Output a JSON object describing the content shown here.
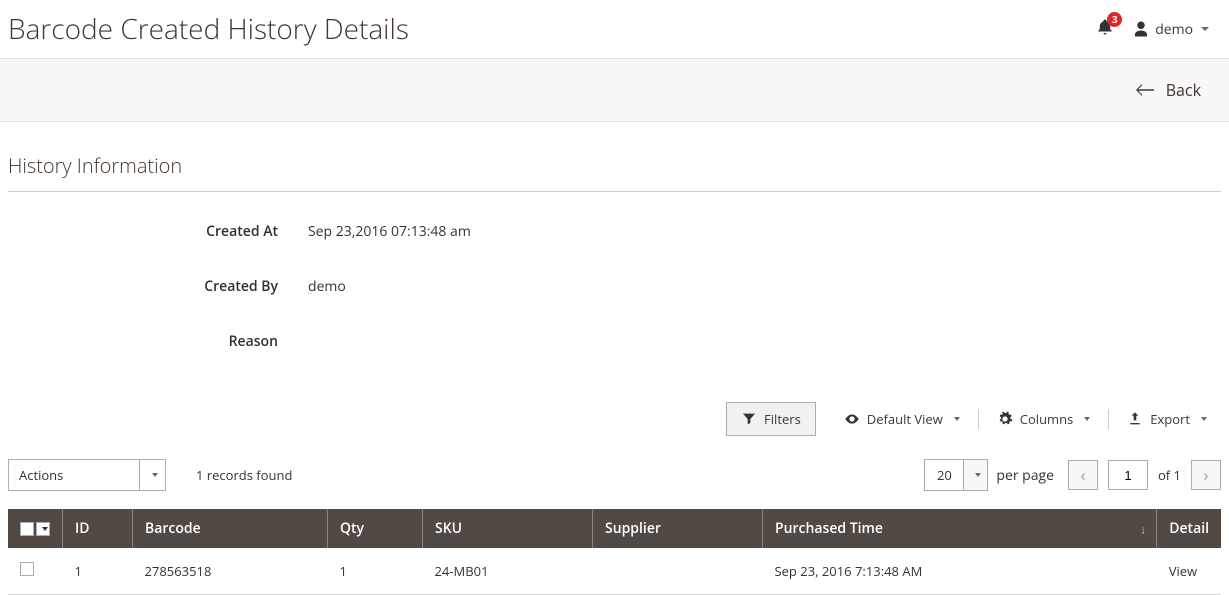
{
  "header": {
    "page_title": "Barcode Created History Details",
    "notification_count": "3",
    "user_name": "demo"
  },
  "back_bar": {
    "back_label": "Back"
  },
  "section": {
    "title": "History Information",
    "rows": {
      "created_at": {
        "label": "Created At",
        "value": "Sep 23,2016 07:13:48 am"
      },
      "created_by": {
        "label": "Created By",
        "value": "demo"
      },
      "reason": {
        "label": "Reason",
        "value": ""
      }
    }
  },
  "toolbar": {
    "filters_label": "Filters",
    "default_view_label": "Default View",
    "columns_label": "Columns",
    "export_label": "Export"
  },
  "grid_controls": {
    "actions_label": "Actions",
    "records_text": "1 records found",
    "per_page_value": "20",
    "per_page_label": "per page",
    "current_page": "1",
    "of_text": "of 1"
  },
  "grid": {
    "headers": {
      "id": "ID",
      "barcode": "Barcode",
      "qty": "Qty",
      "sku": "SKU",
      "supplier": "Supplier",
      "purchased_time": "Purchased Time",
      "detail": "Detail"
    },
    "rows": [
      {
        "id": "1",
        "barcode": "278563518",
        "qty": "1",
        "sku": "24-MB01",
        "supplier": "",
        "purchased_time": "Sep 23, 2016 7:13:48 AM",
        "detail": "View"
      }
    ]
  }
}
